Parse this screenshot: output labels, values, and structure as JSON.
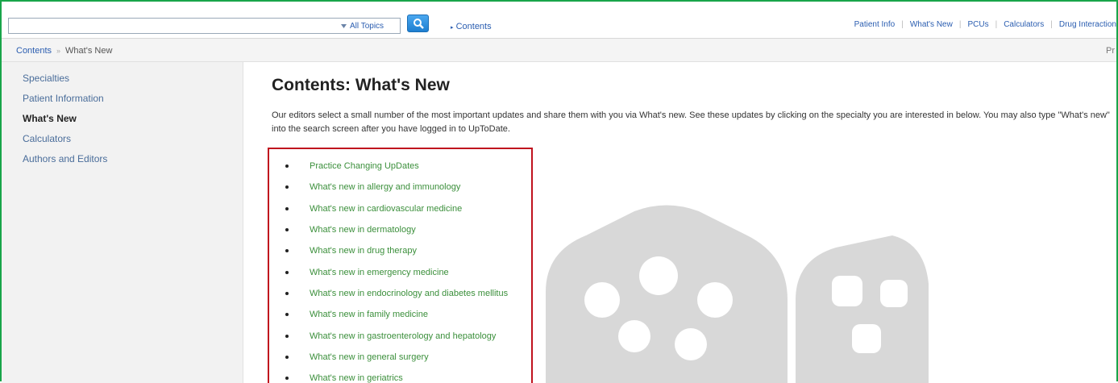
{
  "search": {
    "value": "",
    "placeholder": "",
    "topics_label": "All Topics"
  },
  "header": {
    "contents_link": "Contents",
    "nav": [
      "Patient Info",
      "What's New",
      "PCUs",
      "Calculators",
      "Drug Interaction"
    ]
  },
  "breadcrumb": {
    "root": "Contents",
    "current": "What's New",
    "right_text": "Pr"
  },
  "sidebar": {
    "items": [
      {
        "label": "Specialties"
      },
      {
        "label": "Patient Information"
      },
      {
        "label": "What's New"
      },
      {
        "label": "Calculators"
      },
      {
        "label": "Authors and Editors"
      }
    ]
  },
  "main": {
    "title_prefix": "Contents:",
    "title_main": "What's New",
    "intro": "Our editors select a small number of the most important updates and share them with you via What's new. See these updates by clicking on the specialty you are interested in below. You may also type \"What's new\" into the search screen after you have logged in to UpToDate.",
    "items": [
      "Practice Changing UpDates",
      "What's new in allergy and immunology",
      "What's new in cardiovascular medicine",
      "What's new in dermatology",
      "What's new in drug therapy",
      "What's new in emergency medicine",
      "What's new in endocrinology and diabetes mellitus",
      "What's new in family medicine",
      "What's new in gastroenterology and hepatology",
      "What's new in general surgery",
      "What's new in geriatrics"
    ]
  },
  "colors": {
    "frame": "#19a54a",
    "highlight": "#c0121e",
    "link_green": "#3b8f3b",
    "link_blue": "#2a5db0"
  }
}
